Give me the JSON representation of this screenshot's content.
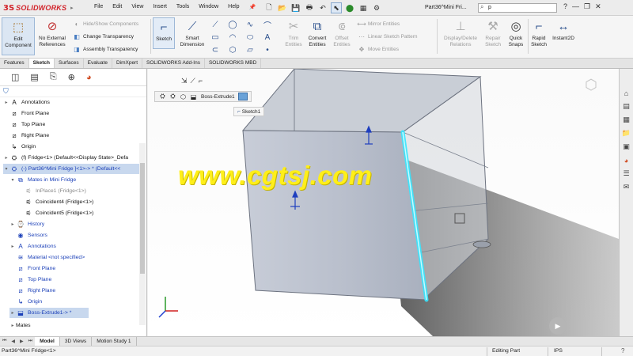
{
  "app": {
    "brand": "SOLIDWORKS",
    "menu": [
      "File",
      "Edit",
      "View",
      "Insert",
      "Tools",
      "Window",
      "Help"
    ],
    "document_title": "Part36^Mini Fri...",
    "search_value": "p"
  },
  "commands": {
    "edit_component": "Edit Component",
    "no_external_references": "No External References",
    "hide_show_components": "Hide/Show Components",
    "change_transparency": "Change Transparency",
    "assembly_transparency": "Assembly Transparency",
    "sketch": "Sketch",
    "smart_dimension": "Smart Dimension",
    "trim_entities": "Trim Entities",
    "convert_entities": "Convert Entities",
    "offset_entities": "Offset Entities",
    "mirror_entities": "Mirror Entities",
    "linear_sketch_pattern": "Linear Sketch Pattern",
    "move_entities": "Move Entities",
    "display_delete_relations": "Display/Delete Relations",
    "repair_sketch": "Repair Sketch",
    "quick_snaps": "Quick Snaps",
    "rapid_sketch": "Rapid Sketch",
    "instant2d": "Instant2D"
  },
  "tabs": [
    "Features",
    "Sketch",
    "Surfaces",
    "Evaluate",
    "DimXpert",
    "SOLIDWORKS Add-Ins",
    "SOLIDWORKS MBD"
  ],
  "tree": {
    "annotations": "Annotations",
    "front_plane": "Front Plane",
    "top_plane": "Top Plane",
    "right_plane": "Right Plane",
    "origin": "Origin",
    "fridge": "(f) Fridge<1> (Default<<Display State>_Defa",
    "part36": "(-) Part36^Mini Fridge ]<1>-> * (Default<<",
    "mates": "Mates in Mini Fridge",
    "inplace1": "InPlace1 (Fridge<1>)",
    "coincident4": "Coincident4 (Fridge<1>)",
    "coincident5": "Coincident5 (Fridge<1>)",
    "history": "History",
    "sensors": "Sensors",
    "annotations2": "Annotations",
    "material": "Material <not specified>",
    "front_plane2": "Front Plane",
    "top_plane2": "Top Plane",
    "right_plane2": "Right Plane",
    "origin2": "Origin",
    "boss_extrude": "Boss-Extrude1-> *",
    "mates_tail": "Mates"
  },
  "viewport": {
    "breadcrumb_feature": "Boss-Extrude1",
    "breadcrumb_sketch": "Sketch1",
    "watermark": "www.cgtsj.com"
  },
  "bottom_tabs": [
    "Model",
    "3D Views",
    "Motion Study 1"
  ],
  "status": {
    "left": "Part36^Mini Fridge<1>",
    "mode": "Editing Part",
    "units": "IPS"
  },
  "colors": {
    "brand_red": "#d2232a",
    "selection_blue": "#c8d8ee",
    "highlight_cyan": "#38e6ff",
    "watermark_yellow": "#ffef1a"
  }
}
